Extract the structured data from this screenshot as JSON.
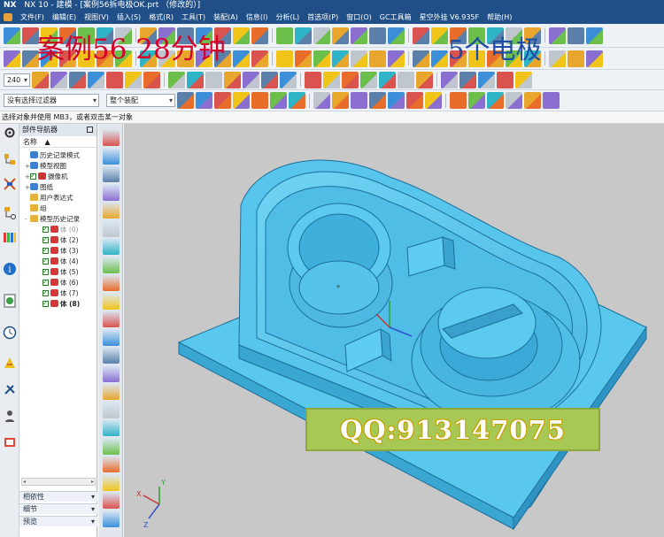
{
  "window": {
    "app": "NX",
    "title": "NX 10 - 建模 - [案例56拆电极OK.prt （修改的）]"
  },
  "menu": [
    "文件(F)",
    "编辑(E)",
    "视图(V)",
    "插入(S)",
    "格式(R)",
    "工具(T)",
    "装配(A)",
    "信息(I)",
    "分析(L)",
    "首选项(P)",
    "窗口(O)",
    "GC工具箱",
    "星空外挂 V6.935F",
    "帮助(H)"
  ],
  "overlay_text": {
    "left": "案例56   28分钟",
    "right": "5个电极"
  },
  "toolbar": {
    "zoom_value": "240",
    "selection_filter": "没有选择过滤器",
    "assembly_scope": "整个装配"
  },
  "status_text": "选择对象并使用 MB3，或者双击某一对象",
  "navigator": {
    "title": "部件导航器",
    "column_header": "名称",
    "nodes": [
      {
        "label": "历史记录模式",
        "indent": 1,
        "icon": "history-mode-icon"
      },
      {
        "label": "模型视图",
        "indent": 1,
        "icon": "model-views-icon",
        "expand": "+"
      },
      {
        "label": "摄像机",
        "indent": 1,
        "icon": "camera-icon",
        "expand": "+",
        "check": true
      },
      {
        "label": "图纸",
        "indent": 1,
        "icon": "drawing-icon",
        "expand": "+"
      },
      {
        "label": "用户表达式",
        "indent": 1,
        "icon": "folder-icon"
      },
      {
        "label": "组",
        "indent": 1,
        "icon": "folder-icon"
      },
      {
        "label": "模型历史记录",
        "indent": 1,
        "icon": "folder-icon",
        "expand": "-"
      },
      {
        "label": "体 (0)",
        "indent": 2,
        "icon": "body-icon",
        "check": true,
        "dim": true
      },
      {
        "label": "体 (2)",
        "indent": 2,
        "icon": "body-icon",
        "check": true
      },
      {
        "label": "体 (3)",
        "indent": 2,
        "icon": "body-icon",
        "check": true
      },
      {
        "label": "体 (4)",
        "indent": 2,
        "icon": "body-icon",
        "check": true
      },
      {
        "label": "体 (5)",
        "indent": 2,
        "icon": "body-icon",
        "check": true
      },
      {
        "label": "体 (6)",
        "indent": 2,
        "icon": "body-icon",
        "check": true
      },
      {
        "label": "体 (7)",
        "indent": 2,
        "icon": "body-icon",
        "check": true
      },
      {
        "label": "体 (8)",
        "indent": 2,
        "icon": "body-icon",
        "check": true,
        "bold": true
      }
    ],
    "footer": [
      "相依性",
      "细节",
      "预览"
    ]
  },
  "viewport": {
    "model_color": "#57c4ea",
    "background": "#c8c8c8",
    "axis_labels": [
      "X",
      "Y",
      "Z"
    ]
  },
  "watermark": "QQ:913147075",
  "colors": {
    "title_bar": "#1f4f86",
    "overlay_red": "#d4002a",
    "overlay_blue": "#1c4ca3",
    "watermark_bg": "#a8c855"
  }
}
